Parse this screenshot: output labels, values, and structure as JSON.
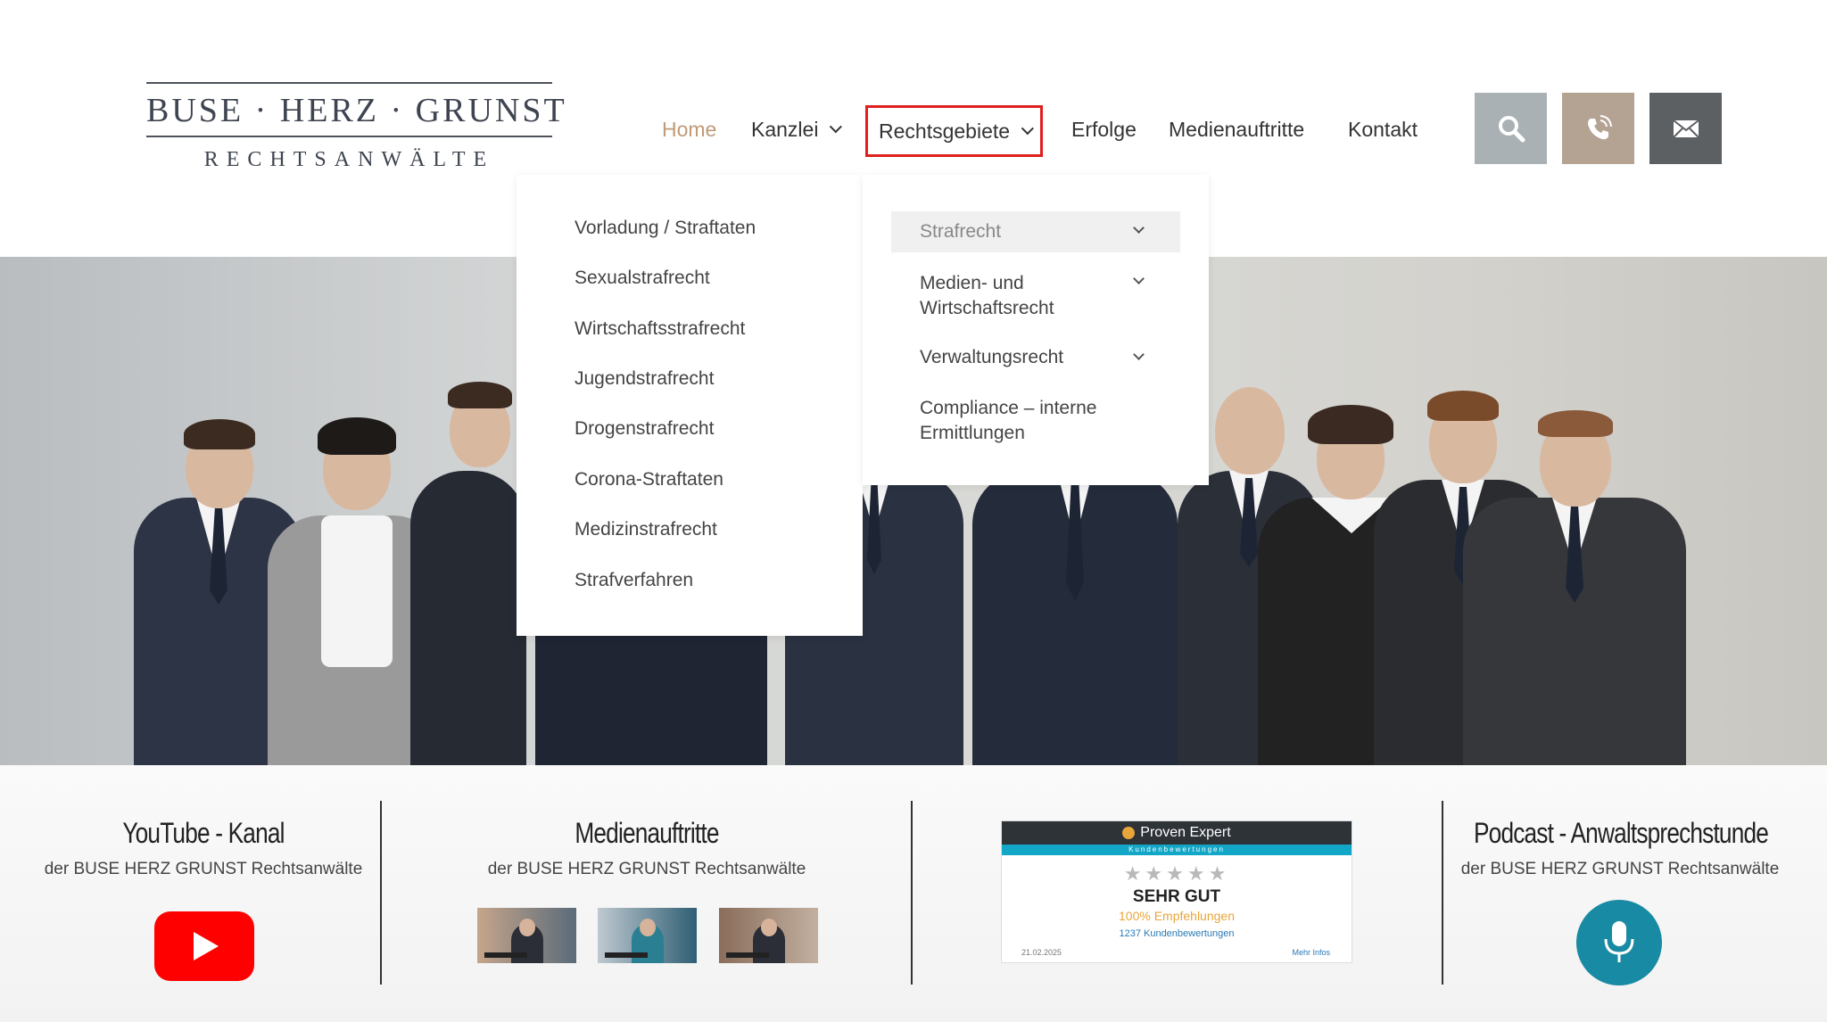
{
  "logo": {
    "line1": "BUSE · HERZ · GRUNST",
    "line2": "RECHTSANWÄLTE"
  },
  "nav": {
    "items": [
      {
        "label": "Home",
        "active": true
      },
      {
        "label": "Kanzlei",
        "has_dropdown": true
      },
      {
        "label": "Rechtsgebiete",
        "has_dropdown": true,
        "highlighted": true
      },
      {
        "label": "Erfolge"
      },
      {
        "label": "Medienauftritte"
      },
      {
        "label": "Kontakt"
      }
    ],
    "buttons": [
      {
        "icon": "search-icon",
        "color": "#a9b1b5"
      },
      {
        "icon": "phone-icon",
        "color": "#b4a293"
      },
      {
        "icon": "mail-icon",
        "color": "#5d6063"
      }
    ]
  },
  "dropdown": {
    "submenu": [
      "Vorladung / Straftaten",
      "Sexualstrafrecht",
      "Wirtschaftsstrafrecht",
      "Jugendstrafrecht",
      "Drogenstrafrecht",
      "Corona-Straftaten",
      "Medizinstrafrecht",
      "Strafverfahren"
    ],
    "categories": [
      {
        "label": "Strafrecht",
        "selected": true
      },
      {
        "label": "Medien- und Wirtschaftsrecht"
      },
      {
        "label": "Verwaltungsrecht"
      },
      {
        "label": "Compliance – interne Ermittlungen"
      }
    ]
  },
  "bottom": {
    "youtube": {
      "title": "YouTube - Kanal",
      "subtitle": "der BUSE HERZ GRUNST Rechtsanwälte"
    },
    "media": {
      "title": "Medienauftritte",
      "subtitle": "der BUSE HERZ GRUNST Rechtsanwälte"
    },
    "proven_expert": {
      "brand": "Proven Expert",
      "strip": "Kundenbewertungen",
      "stars": "★★★★★",
      "verdict": "SEHR GUT",
      "recommendation": "100% Empfehlungen",
      "reviews": "1237 Kundenbewertungen",
      "date": "21.02.2025",
      "more": "Mehr Infos"
    },
    "podcast": {
      "title": "Podcast - Anwaltsprechstunde",
      "subtitle": "der BUSE HERZ GRUNST Rechtsanwälte"
    }
  },
  "colors": {
    "accent": "#c19a78",
    "highlight_border": "#e02020",
    "youtube_red": "#ff0000",
    "podcast_teal": "#188aa3"
  }
}
